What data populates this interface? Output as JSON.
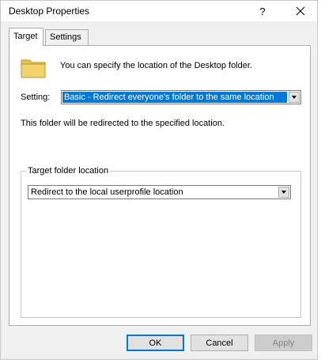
{
  "window": {
    "title": "Desktop Properties",
    "help_glyph": "?"
  },
  "tabs": [
    {
      "label": "Target",
      "active": true
    },
    {
      "label": "Settings",
      "active": false
    }
  ],
  "target_tab": {
    "intro": "You can specify the location of the Desktop folder.",
    "setting_label": "Setting:",
    "setting_value": "Basic - Redirect everyone's folder to the same location",
    "redirect_note": "This folder will be redirected to the specified location.",
    "group_label": "Target folder location",
    "location_value": "Redirect to the local userprofile location"
  },
  "buttons": {
    "ok": "OK",
    "cancel": "Cancel",
    "apply": "Apply"
  },
  "colors": {
    "selection": "#0078d7",
    "folder": "#e8c34a"
  },
  "icons": {
    "folder": "folder-icon",
    "close": "close-icon"
  }
}
